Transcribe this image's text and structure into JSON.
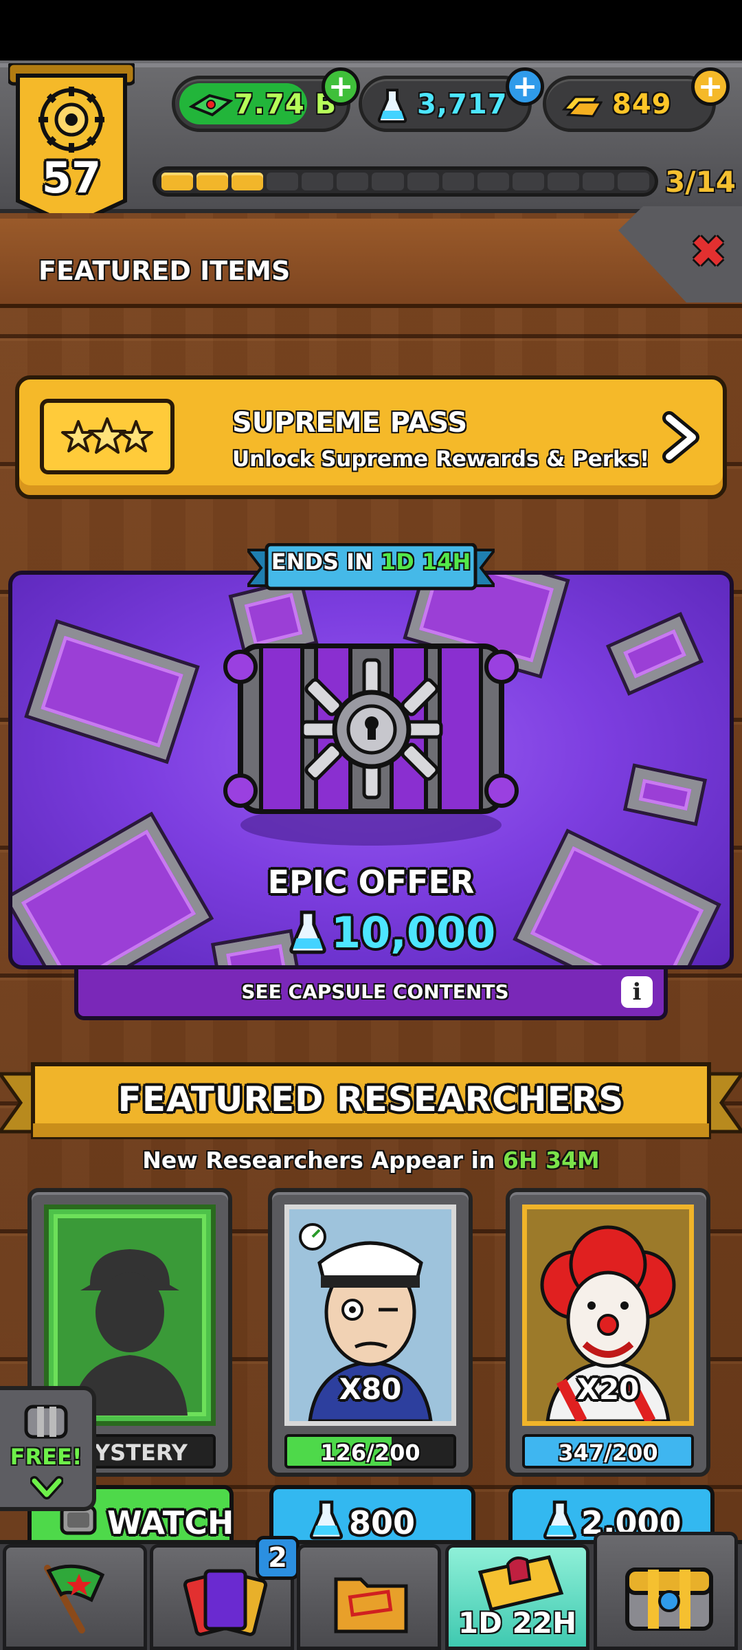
{
  "player": {
    "level": "57"
  },
  "currencies": {
    "cash": "7.74 B",
    "flasks": "3,717",
    "gold": "849"
  },
  "progress": {
    "label": "3/14",
    "filled": 3,
    "total": 14
  },
  "header": {
    "title": "FEATURED ITEMS"
  },
  "supreme_pass": {
    "title": "SUPREME PASS",
    "subtitle": "Unlock Supreme Rewards & Perks!"
  },
  "epic_offer": {
    "ends_prefix": "ENDS IN",
    "ends_days": "1D",
    "ends_hours": "14H",
    "title": "EPIC OFFER",
    "price": "10,000",
    "contents_label": "SEE CAPSULE CONTENTS"
  },
  "researchers": {
    "title": "FEATURED RESEARCHERS",
    "subtitle_prefix": "New Researchers Appear in",
    "timer": "6H 34M",
    "cards": [
      {
        "name": "MYSTERY",
        "button": "WATCH"
      },
      {
        "count": "X80",
        "progress_text": "126/200",
        "progress": 0.63,
        "price": "800"
      },
      {
        "count": "X20",
        "progress_text": "347/200",
        "progress": 1.0,
        "price": "2,000"
      }
    ],
    "free_badge": "FREE!"
  },
  "nav": {
    "badge_count": "2",
    "event_timer": "1D 22H"
  },
  "colors": {
    "accent_gold": "#f5b929",
    "cash_green": "#22b53a",
    "flask_blue": "#4de6ff",
    "offer_purple": "#7d3ee0",
    "close_red": "#e23030"
  },
  "icons": [
    "badge-gear-icon",
    "cash-icon",
    "flask-icon",
    "gold-bar-icon",
    "plus-icon",
    "close-icon",
    "stars-icon",
    "chevron-right-icon",
    "capsule-chest-icon",
    "info-icon",
    "flag-icon",
    "cards-icon",
    "folder-icon",
    "ticket-icon",
    "treasure-chest-icon"
  ]
}
